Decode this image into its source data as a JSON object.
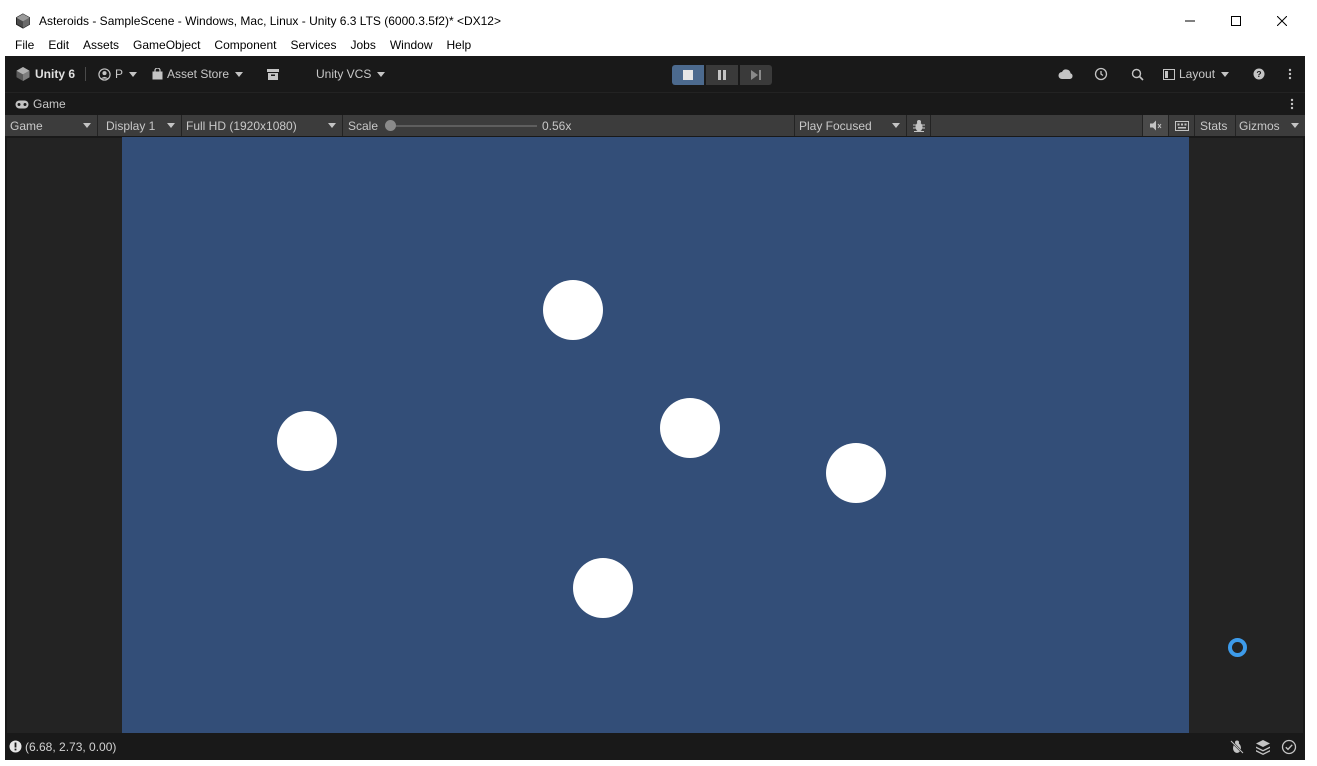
{
  "window": {
    "title": "Asteroids - SampleScene - Windows, Mac, Linux - Unity 6.3 LTS (6000.3.5f2)* <DX12>"
  },
  "menu": [
    "File",
    "Edit",
    "Assets",
    "GameObject",
    "Component",
    "Services",
    "Jobs",
    "Window",
    "Help"
  ],
  "toolbar": {
    "unity_label": "Unity 6",
    "account_label": "P",
    "asset_store_label": "Asset Store",
    "vcs_label": "Unity VCS",
    "layout_label": "Layout"
  },
  "tab": {
    "label": "Game"
  },
  "gamebar": {
    "view_mode": "Game",
    "display": "Display 1",
    "resolution": "Full HD (1920x1080)",
    "scale_label": "Scale",
    "scale_value": "0.56x",
    "scale_fraction": 0.0,
    "play_mode": "Play Focused",
    "stats_label": "Stats",
    "gizmos_label": "Gizmos"
  },
  "game": {
    "background": "#334e78",
    "asteroid_count": 5
  },
  "status": {
    "coords": "(6.68, 2.73, 0.00)"
  },
  "colors": {
    "accent": "#3d9bea",
    "play_active": "#4c6a8e"
  }
}
